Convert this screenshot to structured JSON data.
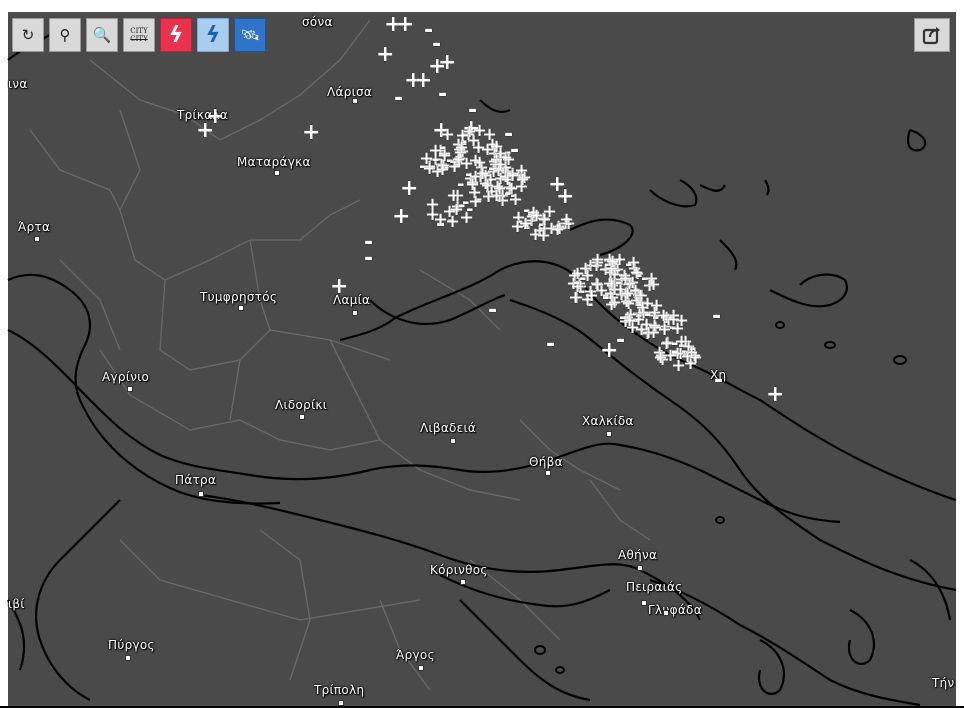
{
  "toolbar": {
    "buttons": [
      {
        "name": "refresh-button",
        "icon": "refresh-icon",
        "glyph": "↻",
        "style": ""
      },
      {
        "name": "locate-button",
        "icon": "location-pin-icon",
        "glyph": "⚲",
        "style": ""
      },
      {
        "name": "zoom-out-button",
        "icon": "zoom-out-icon",
        "glyph": "🔍",
        "style": ""
      },
      {
        "name": "city-toggle-button",
        "icon": "city-toggle-icon",
        "glyph": "",
        "style": "city"
      },
      {
        "name": "lightning-toggle-button",
        "icon": "lightning-icon",
        "glyph": "ϟ",
        "style": "red"
      },
      {
        "name": "ground-strike-toggle-button",
        "icon": "ground-strike-icon",
        "glyph": "ϟ",
        "style": "light"
      },
      {
        "name": "satellite-toggle-button",
        "icon": "satellite-icon",
        "glyph": "🛰",
        "style": "blue"
      }
    ],
    "city_text_top": "CITY",
    "city_text_bottom": "CITY"
  },
  "share": {
    "icon": "share-icon"
  },
  "places": [
    {
      "name": "Λάρισα",
      "dot": true
    },
    {
      "name": "Τρίκαλα",
      "dot": false
    },
    {
      "name": "Ματαράγκα",
      "dot": true
    },
    {
      "name": "Άρτα",
      "dot": true
    },
    {
      "name": "Τυμφρηστός",
      "dot": true
    },
    {
      "name": "Λαμία",
      "dot": true
    },
    {
      "name": "Αγρίνιο",
      "dot": true
    },
    {
      "name": "Λιδορίκι",
      "dot": true
    },
    {
      "name": "Λιβαδειά",
      "dot": true
    },
    {
      "name": "Χαλκίδα",
      "dot": true
    },
    {
      "name": "Θήβα",
      "dot": true
    },
    {
      "name": "Πάτρα",
      "dot": true
    },
    {
      "name": "Αθήνα",
      "dot": true
    },
    {
      "name": "Κόρινθος",
      "dot": true
    },
    {
      "name": "Πειραιάς",
      "dot": true
    },
    {
      "name": "Γλυφάδα",
      "dot": true
    },
    {
      "name": "Πύργος",
      "dot": true
    },
    {
      "name": "Άργος",
      "dot": true
    },
    {
      "name": "Τρίπολη",
      "dot": true
    },
    {
      "name": "ιβί",
      "dot": false
    },
    {
      "name": "ινα",
      "dot": false
    },
    {
      "name": "σόνα",
      "dot": false
    },
    {
      "name": "Χη",
      "dot": false
    },
    {
      "name": "Tήν",
      "dot": false
    }
  ],
  "colors": {
    "land": "#4a4a4a",
    "coast": "#000000",
    "border": "#6a6a6a",
    "strike": "#ffffff",
    "lightning_button": "#e8324e",
    "ground_button": "#a8cdee",
    "satellite_button": "#2f74c9"
  },
  "legend": {
    "positive": "+",
    "negative": "-"
  }
}
